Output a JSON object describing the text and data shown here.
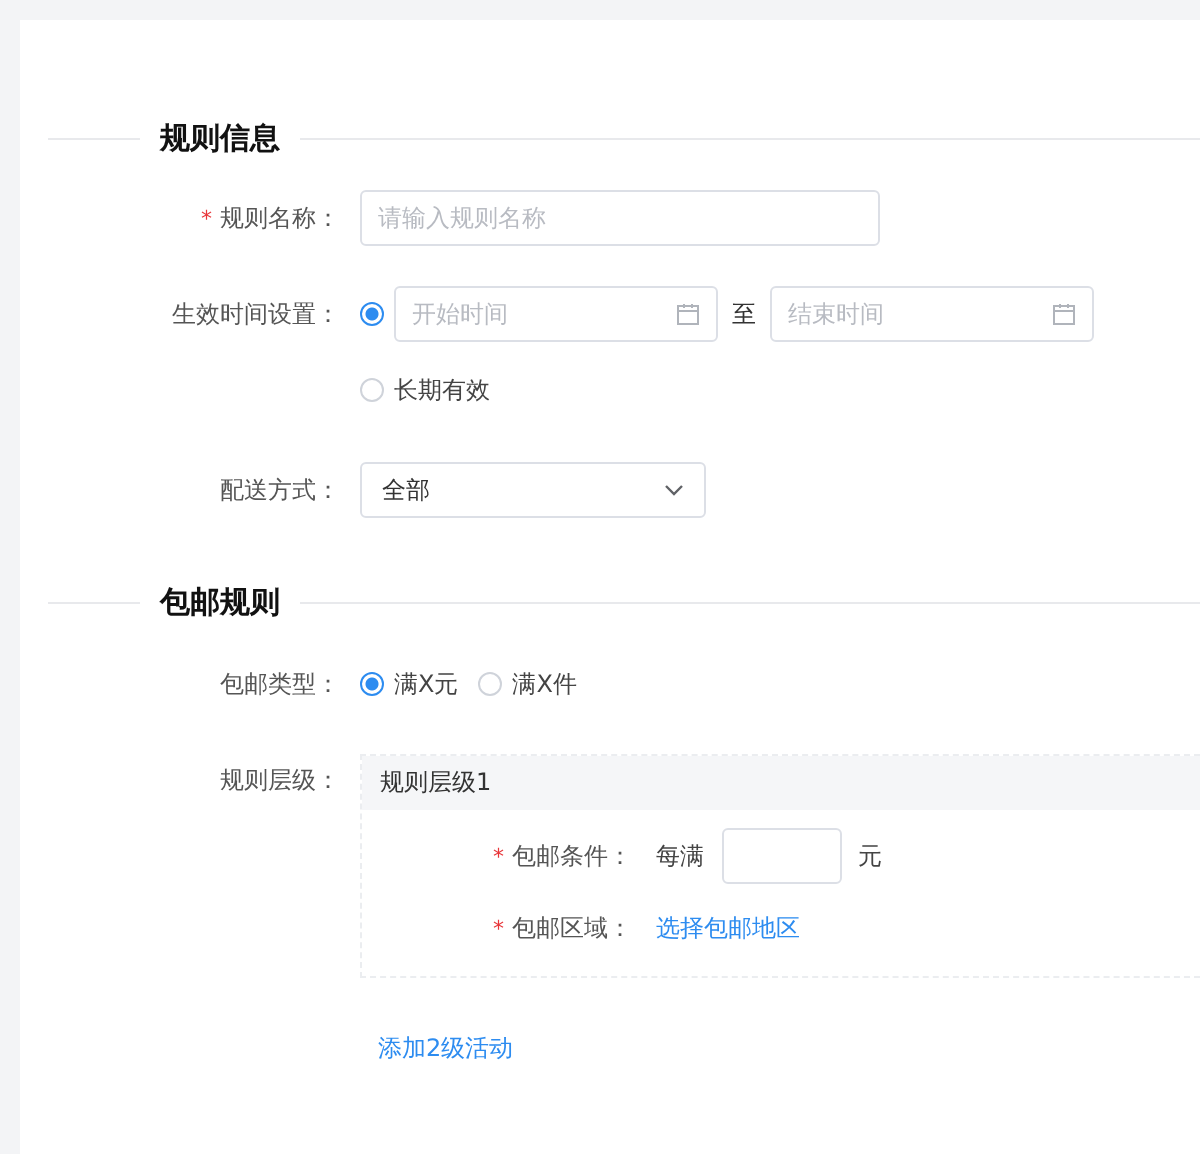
{
  "sections": [
    {
      "title": "规则信息",
      "fields": [
        {
          "kind": "text",
          "label": "规则名称：",
          "mark": "*",
          "placeholder": "请输入规则名称"
        },
        {
          "kind": "time",
          "label": "生效时间设置：",
          "options": [
            {
              "kind": "range",
              "selected": true,
              "start_placeholder": "开始时间",
              "separator": "至",
              "end_placeholder": "结束时间"
            },
            {
              "kind": "plain",
              "selected": false,
              "label": "长期有效"
            }
          ]
        },
        {
          "kind": "select",
          "label": "配送方式：",
          "value": "全部"
        }
      ]
    },
    {
      "title": "包邮规则",
      "fields": [
        {
          "kind": "radio",
          "label": "包邮类型：",
          "options": [
            {
              "label": "满X元",
              "selected": true
            },
            {
              "label": "满X件",
              "selected": false
            }
          ]
        },
        {
          "kind": "levels",
          "label": "规则层级：",
          "levels": [
            {
              "title": "规则层级1",
              "rows": [
                {
                  "kind": "amount",
                  "label": "包邮条件：",
                  "mark": "*",
                  "prefix": "每满",
                  "suffix": "元"
                },
                {
                  "kind": "link",
                  "label": "包邮区域：",
                  "mark": "*",
                  "link": "选择包邮地区"
                }
              ]
            }
          ],
          "add_link": "添加2级活动"
        }
      ]
    }
  ]
}
